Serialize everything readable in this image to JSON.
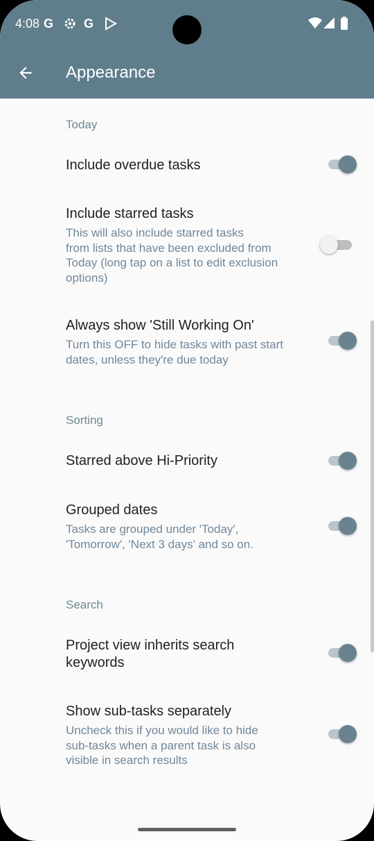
{
  "status_bar": {
    "time": "4:08",
    "icons": [
      "google-icon",
      "settings-gear-icon",
      "google-icon",
      "play-store-icon",
      "wifi-icon",
      "signal-icon",
      "battery-icon"
    ]
  },
  "app_bar": {
    "title": "Appearance",
    "back_icon": "arrow-back-icon"
  },
  "colors": {
    "app_bar": "#607d8b",
    "section_header": "#6e8795",
    "switch_thumb_on": "#6a8290",
    "switch_track_on": "#b8c6cf",
    "background": "#fafafa"
  },
  "sections": [
    {
      "header": "Today",
      "items": [
        {
          "title": "Include overdue tasks",
          "subtitle": "",
          "enabled": true
        },
        {
          "title": "Include starred tasks",
          "subtitle_lines": [
            "This will also include starred tasks",
            "from lists that have been excluded from",
            "Today (long tap on a list to edit exclusion",
            "options)"
          ],
          "enabled": false
        },
        {
          "title": "Always show 'Still Working On'",
          "subtitle_lines": [
            "Turn this OFF to hide tasks with past start",
            "dates, unless they're due today"
          ],
          "enabled": true
        }
      ]
    },
    {
      "header": "Sorting",
      "items": [
        {
          "title": "Starred above Hi-Priority",
          "subtitle": "",
          "enabled": true
        },
        {
          "title": "Grouped dates",
          "subtitle_lines": [
            "Tasks are grouped under 'Today',",
            "'Tomorrow', 'Next 3 days' and so on."
          ],
          "enabled": true
        }
      ]
    },
    {
      "header": "Search",
      "items": [
        {
          "title_lines": [
            "Project view inherits search",
            "keywords"
          ],
          "subtitle": "",
          "enabled": true
        },
        {
          "title": "Show sub-tasks separately",
          "subtitle_lines": [
            "Uncheck this if you would like to hide",
            "sub-tasks when a parent task is also",
            "visible in search results"
          ],
          "enabled": true
        }
      ]
    }
  ]
}
